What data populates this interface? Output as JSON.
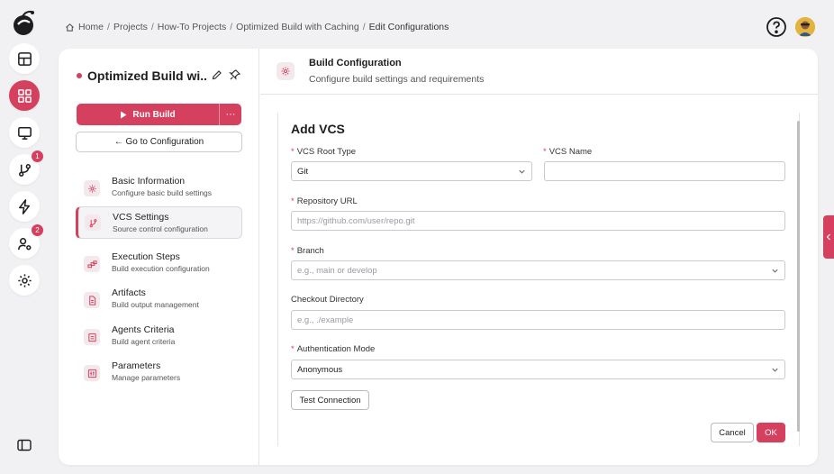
{
  "breadcrumb": {
    "items": [
      "Home",
      "Projects",
      "How-To Projects",
      "Optimized Build with Caching",
      "Edit Configurations"
    ],
    "separator": "/"
  },
  "rail": {
    "items": [
      {
        "name": "dashboard",
        "icon": "table-grid-icon",
        "active": false
      },
      {
        "name": "projects",
        "icon": "apps-grid-icon",
        "active": true
      },
      {
        "name": "agents",
        "icon": "monitor-icon",
        "active": false
      },
      {
        "name": "vcs",
        "icon": "git-branch-icon",
        "active": false,
        "badge": "1"
      },
      {
        "name": "events",
        "icon": "bolt-icon",
        "active": false
      },
      {
        "name": "users",
        "icon": "user-settings-icon",
        "active": false,
        "badge": "2"
      },
      {
        "name": "settings",
        "icon": "gear-icon",
        "active": false
      }
    ]
  },
  "project": {
    "name": "Optimized Build wi...",
    "run_label": "Run Build",
    "more_label": "···",
    "goto_label": "← Go to Configuration"
  },
  "nav": [
    {
      "title": "Basic Information",
      "subtitle": "Configure basic build settings",
      "icon": "gear-icon",
      "active": false
    },
    {
      "title": "VCS Settings",
      "subtitle": "Source control configuration",
      "icon": "git-branch-icon",
      "active": true
    },
    {
      "title": "Execution Steps",
      "subtitle": "Build execution configuration",
      "icon": "steps-icon",
      "active": false
    },
    {
      "title": "Artifacts",
      "subtitle": "Build output management",
      "icon": "file-icon",
      "active": false
    },
    {
      "title": "Agents Criteria",
      "subtitle": "Build agent criteria",
      "icon": "agent-icon",
      "active": false
    },
    {
      "title": "Parameters",
      "subtitle": "Manage parameters",
      "icon": "sliders-icon",
      "active": false
    }
  ],
  "header": {
    "title": "Build Configuration",
    "subtitle": "Configure build settings and requirements"
  },
  "form": {
    "title": "Add VCS",
    "vcs_root_type": {
      "label": "VCS Root Type",
      "required": true,
      "value": "Git"
    },
    "vcs_name": {
      "label": "VCS Name",
      "required": true,
      "value": ""
    },
    "repository_url": {
      "label": "Repository URL",
      "required": true,
      "placeholder": "https://github.com/user/repo.git"
    },
    "branch": {
      "label": "Branch",
      "required": true,
      "placeholder": "e.g., main or develop"
    },
    "checkout_directory": {
      "label": "Checkout Directory",
      "required": false,
      "placeholder": "e.g., ./example"
    },
    "authentication_mode": {
      "label": "Authentication Mode",
      "required": true,
      "value": "Anonymous"
    },
    "test_connection_label": "Test Connection",
    "cancel_label": "Cancel",
    "ok_label": "OK"
  },
  "colors": {
    "accent": "#d6405f",
    "background": "#f1f1f3",
    "card": "#ffffff",
    "border": "#e4e4e7"
  }
}
